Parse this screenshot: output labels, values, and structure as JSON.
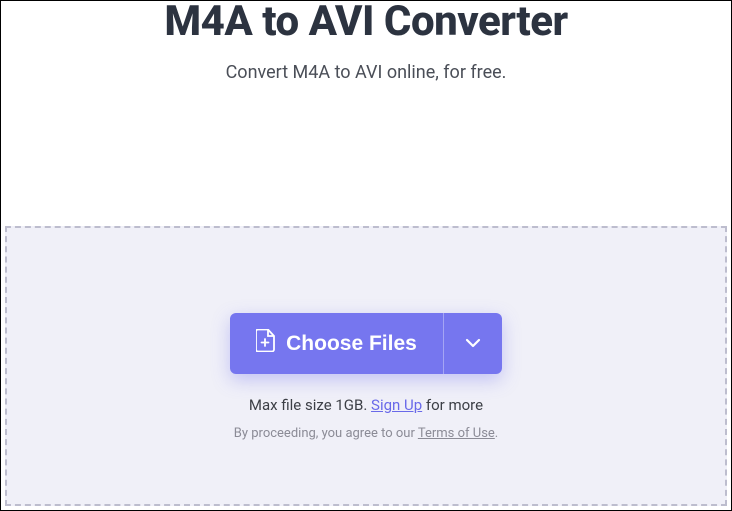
{
  "header": {
    "title": "M4A to AVI Converter",
    "subtitle": "Convert M4A to AVI online, for free."
  },
  "dropzone": {
    "choose_label": "Choose Files",
    "info_prefix": "Max file size 1GB. ",
    "signup_label": "Sign Up",
    "info_suffix": " for more",
    "terms_prefix": "By proceeding, you agree to our ",
    "terms_label": "Terms of Use",
    "terms_suffix": "."
  }
}
